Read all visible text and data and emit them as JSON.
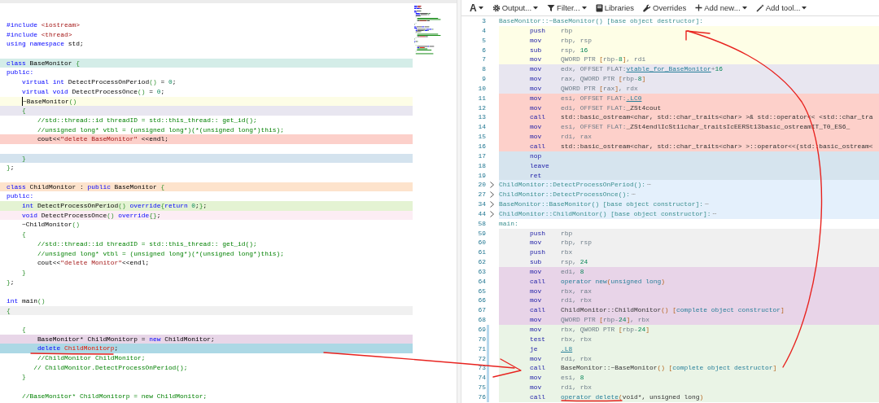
{
  "code_editor": {
    "lines": [
      {
        "kind": "code",
        "tokens": [
          {
            "t": "#include",
            "kind": "kw"
          },
          {
            "t": " <iostream>",
            "kind": "inc"
          }
        ]
      },
      {
        "kind": "code",
        "tokens": [
          {
            "t": "#include",
            "kind": "kw"
          },
          {
            "t": " <thread>",
            "kind": "inc"
          }
        ]
      },
      {
        "kind": "code",
        "tokens": [
          {
            "t": "using",
            "kind": "kw"
          },
          {
            "t": " namespace",
            "kind": "kw"
          },
          {
            "t": " std;",
            "kind": "txt"
          }
        ]
      },
      {
        "kind": "blank"
      },
      {
        "kind": "code",
        "color": "#d4ede8",
        "tokens": [
          {
            "t": "class",
            "kind": "kw"
          },
          {
            "t": " BaseMonitor ",
            "kind": "txt"
          },
          {
            "t": "{",
            "kind": "br"
          }
        ]
      },
      {
        "kind": "code",
        "tokens": [
          {
            "t": "public:",
            "kind": "kw"
          }
        ]
      },
      {
        "kind": "code",
        "tokens": [
          {
            "t": "    virtual int",
            "kind": "kw"
          },
          {
            "t": " DetectProcessOnPeriod",
            "kind": "txt"
          },
          {
            "t": "()",
            "kind": "br"
          },
          {
            "t": " = ",
            "kind": "txt"
          },
          {
            "t": "0",
            "kind": "num"
          },
          {
            "t": ";",
            "kind": "txt"
          }
        ]
      },
      {
        "kind": "code",
        "tokens": [
          {
            "t": "    virtual void",
            "kind": "kw"
          },
          {
            "t": " DetectProcessOnce",
            "kind": "txt"
          },
          {
            "t": "()",
            "kind": "br"
          },
          {
            "t": " = ",
            "kind": "txt"
          },
          {
            "t": "0",
            "kind": "num"
          },
          {
            "t": ";",
            "kind": "txt"
          }
        ]
      },
      {
        "kind": "code",
        "color": "#fdfde6",
        "cursor": true,
        "tokens": [
          {
            "t": "    ~BaseMonitor",
            "kind": "txt"
          },
          {
            "t": "()",
            "kind": "br"
          }
        ]
      },
      {
        "kind": "code",
        "color": "#e8e6f0",
        "tokens": [
          {
            "t": "    {",
            "kind": "br"
          }
        ]
      },
      {
        "kind": "code",
        "tokens": [
          {
            "t": "        //std::thread::id threadID = std::this_thread:: get_id();",
            "kind": "cm"
          }
        ]
      },
      {
        "kind": "code",
        "tokens": [
          {
            "t": "        //unsigned long* vtbl = (unsigned long*)(*(unsigned long*)this);",
            "kind": "cm"
          }
        ]
      },
      {
        "kind": "code",
        "color": "#fcd0ca",
        "tokens": [
          {
            "t": "        cout<<",
            "kind": "txt"
          },
          {
            "t": "\"delete BaseMonitor\"",
            "kind": "str"
          },
          {
            "t": " <<endl;",
            "kind": "txt"
          }
        ]
      },
      {
        "kind": "blank"
      },
      {
        "kind": "code",
        "color": "#d4e3ee",
        "tokens": [
          {
            "t": "    }",
            "kind": "br"
          }
        ]
      },
      {
        "kind": "code",
        "tokens": [
          {
            "t": "}",
            "kind": "br"
          },
          {
            "t": ";",
            "kind": "txt"
          }
        ]
      },
      {
        "kind": "blank"
      },
      {
        "kind": "code",
        "color": "#fde3cc",
        "tokens": [
          {
            "t": "class",
            "kind": "kw"
          },
          {
            "t": " ChildMonitor : ",
            "kind": "txt"
          },
          {
            "t": "public",
            "kind": "kw"
          },
          {
            "t": " BaseMonitor ",
            "kind": "txt"
          },
          {
            "t": "{",
            "kind": "br"
          }
        ]
      },
      {
        "kind": "code",
        "tokens": [
          {
            "t": "public:",
            "kind": "kw"
          }
        ]
      },
      {
        "kind": "code",
        "color": "#e4f3d3",
        "tokens": [
          {
            "t": "    int",
            "kind": "kw"
          },
          {
            "t": " DetectProcessOnPeriod",
            "kind": "txt"
          },
          {
            "t": "()",
            "kind": "br"
          },
          {
            "t": " override",
            "kind": "kw"
          },
          {
            "t": "{",
            "kind": "br"
          },
          {
            "t": "return",
            "kind": "kw"
          },
          {
            "t": " 0",
            "kind": "num"
          },
          {
            "t": ";",
            "kind": "txt"
          },
          {
            "t": "}",
            "kind": "br"
          },
          {
            "t": ";",
            "kind": "txt"
          }
        ]
      },
      {
        "kind": "code",
        "color": "#fcedf4",
        "tokens": [
          {
            "t": "    void",
            "kind": "kw"
          },
          {
            "t": " DetectProcessOnce",
            "kind": "txt"
          },
          {
            "t": "()",
            "kind": "br"
          },
          {
            "t": " override",
            "kind": "kw"
          },
          {
            "t": "{}",
            "kind": "br"
          },
          {
            "t": ";",
            "kind": "txt"
          }
        ]
      },
      {
        "kind": "code",
        "tokens": [
          {
            "t": "    ~ChildMonitor",
            "kind": "txt"
          },
          {
            "t": "()",
            "kind": "br"
          }
        ]
      },
      {
        "kind": "code",
        "tokens": [
          {
            "t": "    {",
            "kind": "br"
          }
        ]
      },
      {
        "kind": "code",
        "tokens": [
          {
            "t": "        //std::thread::id threadID = std::this_thread:: get_id();",
            "kind": "cm"
          }
        ]
      },
      {
        "kind": "code",
        "tokens": [
          {
            "t": "        //unsigned long* vtbl = (unsigned long*)(*(unsigned long*)this);",
            "kind": "cm"
          }
        ]
      },
      {
        "kind": "code",
        "tokens": [
          {
            "t": "        cout<<",
            "kind": "txt"
          },
          {
            "t": "\"delete Monitor\"",
            "kind": "str"
          },
          {
            "t": "<<endl;",
            "kind": "txt"
          }
        ]
      },
      {
        "kind": "code",
        "tokens": [
          {
            "t": "    }",
            "kind": "br"
          }
        ]
      },
      {
        "kind": "code",
        "tokens": [
          {
            "t": "}",
            "kind": "br"
          },
          {
            "t": ";",
            "kind": "txt"
          }
        ]
      },
      {
        "kind": "blank"
      },
      {
        "kind": "code",
        "tokens": [
          {
            "t": "int",
            "kind": "kw"
          },
          {
            "t": " main",
            "kind": "txt"
          },
          {
            "t": "()",
            "kind": "br"
          }
        ]
      },
      {
        "kind": "code",
        "color": "#f0f0f0",
        "tokens": [
          {
            "t": "{",
            "kind": "br"
          }
        ]
      },
      {
        "kind": "blank"
      },
      {
        "kind": "code",
        "tokens": [
          {
            "t": "    {",
            "kind": "br"
          }
        ]
      },
      {
        "kind": "code",
        "color": "#e8d6e8",
        "tokens": [
          {
            "t": "        BaseMonitor* ChildMonitorp = ",
            "kind": "txt"
          },
          {
            "t": "new",
            "kind": "kw"
          },
          {
            "t": " ChildMonitor;",
            "kind": "txt"
          }
        ]
      },
      {
        "kind": "code",
        "color": "#acd8e5",
        "tokens": [
          {
            "t": "        delete",
            "kind": "kw"
          },
          {
            "t": " ChildMonitorp",
            "kind": "err"
          },
          {
            "t": ";",
            "kind": "txt"
          }
        ]
      },
      {
        "kind": "code",
        "tokens": [
          {
            "t": "        //ChildMonitor ChildMonitor;",
            "kind": "cm"
          }
        ]
      },
      {
        "kind": "code",
        "tokens": [
          {
            "t": "       // ChildMonitor.DetectProcessOnPeriod();",
            "kind": "cm"
          }
        ]
      },
      {
        "kind": "code",
        "tokens": [
          {
            "t": "    }",
            "kind": "br"
          }
        ]
      },
      {
        "kind": "blank"
      },
      {
        "kind": "code",
        "tokens": [
          {
            "t": "    //BaseMonitor* ChildMonitorp = new ChildMonitor;",
            "kind": "cm"
          }
        ]
      }
    ]
  },
  "toolbar": [
    {
      "label": "A",
      "dropdown": true
    },
    {
      "label": "Output...",
      "dropdown": true
    },
    {
      "label": "Filter...",
      "dropdown": true
    },
    {
      "label": "Libraries",
      "dropdown": false
    },
    {
      "label": "Overrides",
      "dropdown": false
    },
    {
      "label": "Add new...",
      "dropdown": true
    },
    {
      "label": "Add tool...",
      "dropdown": true
    }
  ],
  "assembly": {
    "rows": [
      {
        "number": "3",
        "kind": "label",
        "label": "BaseMonitor::~BaseMonitor() [base object destructor]:"
      },
      {
        "number": "4",
        "kind": "instr",
        "color": "#fefee6",
        "mnemonic": "push",
        "operands": [
          {
            "t": "rbp",
            "kind": "reg"
          }
        ]
      },
      {
        "number": "5",
        "kind": "instr",
        "color": "#fefee6",
        "mnemonic": "mov",
        "operands": [
          {
            "t": "rbp, rsp",
            "kind": "reg"
          }
        ]
      },
      {
        "number": "6",
        "kind": "instr",
        "color": "#fefee6",
        "mnemonic": "sub",
        "operands": [
          {
            "t": "rsp, ",
            "kind": "reg"
          },
          {
            "t": "16",
            "kind": "num"
          }
        ]
      },
      {
        "number": "7",
        "kind": "instr",
        "color": "#fefee6",
        "mnemonic": "mov",
        "operands": [
          {
            "t": "QWORD PTR ",
            "kind": "reg"
          },
          {
            "t": "[",
            "kind": "br"
          },
          {
            "t": "rbp-",
            "kind": "reg"
          },
          {
            "t": "8",
            "kind": "num"
          },
          {
            "t": "]",
            "kind": "br"
          },
          {
            "t": ", rdi",
            "kind": "reg"
          }
        ]
      },
      {
        "number": "8",
        "kind": "instr",
        "color": "#e8e6f0",
        "mnemonic": "mov",
        "operands": [
          {
            "t": "edx, OFFSET FLAT:",
            "kind": "reg"
          },
          {
            "t": "vtable_for_BaseMonitor",
            "kind": "link"
          },
          {
            "t": "+",
            "kind": "reg"
          },
          {
            "t": "16",
            "kind": "num"
          }
        ]
      },
      {
        "number": "9",
        "kind": "instr",
        "color": "#e8e6f0",
        "mnemonic": "mov",
        "operands": [
          {
            "t": "rax, QWORD PTR ",
            "kind": "reg"
          },
          {
            "t": "[",
            "kind": "br"
          },
          {
            "t": "rbp-",
            "kind": "reg"
          },
          {
            "t": "8",
            "kind": "num"
          },
          {
            "t": "]",
            "kind": "br"
          }
        ]
      },
      {
        "number": "10",
        "kind": "instr",
        "color": "#e8e6f0",
        "mnemonic": "mov",
        "operands": [
          {
            "t": "QWORD PTR ",
            "kind": "reg"
          },
          {
            "t": "[",
            "kind": "br"
          },
          {
            "t": "rax",
            "kind": "reg"
          },
          {
            "t": "]",
            "kind": "br"
          },
          {
            "t": ", rdx",
            "kind": "reg"
          }
        ]
      },
      {
        "number": "11",
        "kind": "instr",
        "color": "#fdd0ca",
        "mnemonic": "mov",
        "operands": [
          {
            "t": "esi, OFFSET FLAT:",
            "kind": "reg"
          },
          {
            "t": ".LC0",
            "kind": "link"
          }
        ]
      },
      {
        "number": "12",
        "kind": "instr",
        "color": "#fdd0ca",
        "mnemonic": "mov",
        "operands": [
          {
            "t": "edi, OFFSET FLAT:",
            "kind": "reg"
          },
          {
            "t": "_ZSt4cout",
            "kind": "sym"
          }
        ]
      },
      {
        "number": "13",
        "kind": "instr",
        "color": "#fdd0ca",
        "mnemonic": "call",
        "operands": [
          {
            "t": "std::basic_ostream<char, std::char_traits<char> >& std::operator<< <std::char_tra",
            "kind": "sym"
          }
        ]
      },
      {
        "number": "14",
        "kind": "instr",
        "color": "#fdd0ca",
        "mnemonic": "mov",
        "operands": [
          {
            "t": "esi, OFFSET FLAT:",
            "kind": "reg"
          },
          {
            "t": "_ZSt4endlIcSt11char_traitsIcEERSt13basic_ostreamIT_T0_ES6_",
            "kind": "sym"
          }
        ]
      },
      {
        "number": "15",
        "kind": "instr",
        "color": "#fdd0ca",
        "mnemonic": "mov",
        "operands": [
          {
            "t": "rdi, rax",
            "kind": "reg"
          }
        ]
      },
      {
        "number": "16",
        "kind": "instr",
        "color": "#fdd0ca",
        "mnemonic": "call",
        "operands": [
          {
            "t": "std::basic_ostream<char, std::char_traits<char> >::operator<<(std::basic_ostream<",
            "kind": "sym"
          }
        ]
      },
      {
        "number": "17",
        "kind": "instr",
        "color": "#d6e4ee",
        "mnemonic": "nop"
      },
      {
        "number": "18",
        "kind": "instr",
        "color": "#d6e4ee",
        "mnemonic": "leave"
      },
      {
        "number": "19",
        "kind": "instr",
        "color": "#d6e4ee",
        "mnemonic": "ret"
      },
      {
        "number": "20",
        "kind": "fold",
        "color": "#e4f0fc",
        "collapsed": true,
        "label": "ChildMonitor::DetectProcessOnPeriod():",
        "ellipsis": "⋯"
      },
      {
        "number": "27",
        "kind": "fold",
        "color": "#e4f0fc",
        "collapsed": true,
        "label": "ChildMonitor::DetectProcessOnce():",
        "ellipsis": "⋯"
      },
      {
        "number": "34",
        "kind": "fold",
        "color": "#e4f0fc",
        "collapsed": true,
        "label": "BaseMonitor::BaseMonitor() [base object constructor]:",
        "ellipsis": "⋯"
      },
      {
        "number": "44",
        "kind": "fold",
        "color": "#e4f0fc",
        "collapsed": true,
        "label": "ChildMonitor::ChildMonitor() [base object constructor]:",
        "ellipsis": "⋯"
      },
      {
        "number": "58",
        "kind": "label",
        "label": "main:"
      },
      {
        "number": "59",
        "kind": "instr",
        "color": "#f0f0f0",
        "mnemonic": "push",
        "operands": [
          {
            "t": "rbp",
            "kind": "reg"
          }
        ]
      },
      {
        "number": "60",
        "kind": "instr",
        "color": "#f0f0f0",
        "mnemonic": "mov",
        "operands": [
          {
            "t": "rbp, rsp",
            "kind": "reg"
          }
        ]
      },
      {
        "number": "61",
        "kind": "instr",
        "color": "#f0f0f0",
        "mnemonic": "push",
        "operands": [
          {
            "t": "rbx",
            "kind": "reg"
          }
        ]
      },
      {
        "number": "62",
        "kind": "instr",
        "color": "#f0f0f0",
        "mnemonic": "sub",
        "operands": [
          {
            "t": "rsp, ",
            "kind": "reg"
          },
          {
            "t": "24",
            "kind": "num"
          }
        ]
      },
      {
        "number": "63",
        "kind": "instr",
        "color": "#e8d4e8",
        "mnemonic": "mov",
        "operands": [
          {
            "t": "edi, ",
            "kind": "reg"
          },
          {
            "t": "8",
            "kind": "num"
          }
        ]
      },
      {
        "number": "64",
        "kind": "instr",
        "color": "#e8d4e8",
        "mnemonic": "call",
        "operands": [
          {
            "t": "operator new",
            "kind": "teal"
          },
          {
            "t": "(",
            "kind": "br"
          },
          {
            "t": "unsigned long",
            "kind": "teal"
          },
          {
            "t": ")",
            "kind": "br"
          }
        ]
      },
      {
        "number": "65",
        "kind": "instr",
        "color": "#e8d4e8",
        "mnemonic": "mov",
        "operands": [
          {
            "t": "rbx, rax",
            "kind": "reg"
          }
        ]
      },
      {
        "number": "66",
        "kind": "instr",
        "color": "#e8d4e8",
        "mnemonic": "mov",
        "operands": [
          {
            "t": "rdi, rbx",
            "kind": "reg"
          }
        ]
      },
      {
        "number": "67",
        "kind": "instr",
        "color": "#e8d4e8",
        "mnemonic": "call",
        "operands": [
          {
            "t": "ChildMonitor::ChildMonitor",
            "kind": "sym"
          },
          {
            "t": "() [",
            "kind": "br"
          },
          {
            "t": "complete object constructor",
            "kind": "teal"
          },
          {
            "t": "]",
            "kind": "br"
          }
        ]
      },
      {
        "number": "68",
        "kind": "instr",
        "color": "#e8d4e8",
        "mnemonic": "mov",
        "operands": [
          {
            "t": "QWORD PTR ",
            "kind": "reg"
          },
          {
            "t": "[",
            "kind": "br"
          },
          {
            "t": "rbp-",
            "kind": "reg"
          },
          {
            "t": "24",
            "kind": "num"
          },
          {
            "t": "]",
            "kind": "br"
          },
          {
            "t": ", rbx",
            "kind": "reg"
          }
        ]
      },
      {
        "number": "69",
        "kind": "instr",
        "color": "#eaf4e6",
        "linked": true,
        "mnemonic": "mov",
        "operands": [
          {
            "t": "rbx, QWORD PTR ",
            "kind": "reg"
          },
          {
            "t": "[",
            "kind": "br"
          },
          {
            "t": "rbp-",
            "kind": "reg"
          },
          {
            "t": "24",
            "kind": "num"
          },
          {
            "t": "]",
            "kind": "br"
          }
        ]
      },
      {
        "number": "70",
        "kind": "instr",
        "color": "#eaf4e6",
        "linked": true,
        "mnemonic": "test",
        "operands": [
          {
            "t": "rbx, rbx",
            "kind": "reg"
          }
        ]
      },
      {
        "number": "71",
        "kind": "instr",
        "color": "#eaf4e6",
        "linked": true,
        "mnemonic": "je",
        "operands": [
          {
            "t": ".L8",
            "kind": "link"
          }
        ]
      },
      {
        "number": "72",
        "kind": "instr",
        "color": "#eaf4e6",
        "linked": true,
        "mnemonic": "mov",
        "operands": [
          {
            "t": "rdi, rbx",
            "kind": "reg"
          }
        ]
      },
      {
        "number": "73",
        "kind": "instr",
        "color": "#eaf4e6",
        "linked": true,
        "mnemonic": "call",
        "operands": [
          {
            "t": "BaseMonitor::~BaseMonitor",
            "kind": "sym"
          },
          {
            "t": "() [",
            "kind": "br"
          },
          {
            "t": "complete object destructor",
            "kind": "teal"
          },
          {
            "t": "]",
            "kind": "br"
          }
        ]
      },
      {
        "number": "74",
        "kind": "instr",
        "color": "#eaf4e6",
        "linked": true,
        "mnemonic": "mov",
        "operands": [
          {
            "t": "esi, ",
            "kind": "reg"
          },
          {
            "t": "8",
            "kind": "num"
          }
        ]
      },
      {
        "number": "75",
        "kind": "instr",
        "color": "#eaf4e6",
        "linked": true,
        "mnemonic": "mov",
        "operands": [
          {
            "t": "rdi, rbx",
            "kind": "reg"
          }
        ]
      },
      {
        "number": "76",
        "kind": "instr",
        "color": "#eaf4e6",
        "linked": true,
        "mnemonic": "call",
        "operands": [
          {
            "t": "operator delete",
            "kind": "teal"
          },
          {
            "t": "(",
            "kind": "br"
          },
          {
            "t": "void*, unsigned long",
            "kind": "sym"
          },
          {
            "t": ")",
            "kind": "br"
          }
        ]
      }
    ]
  },
  "annotations": [
    {
      "kind": "underline"
    },
    {
      "kind": "arrow"
    },
    {
      "kind": "arrow"
    },
    {
      "kind": "underline"
    }
  ]
}
